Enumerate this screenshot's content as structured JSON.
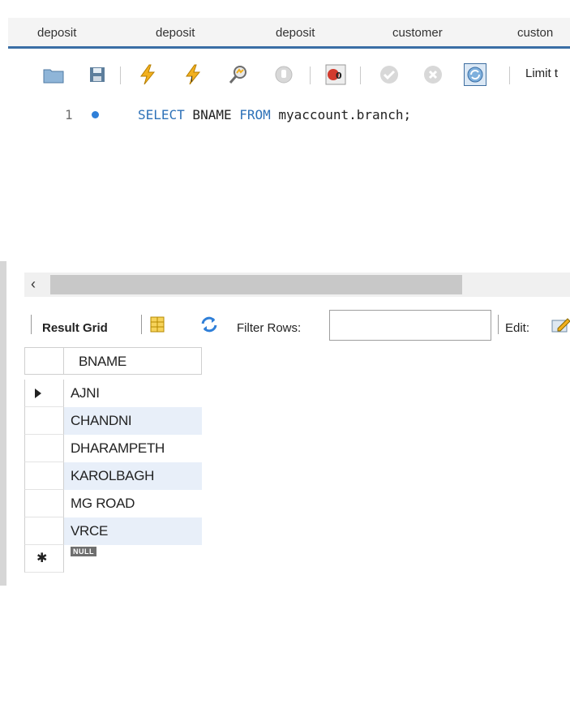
{
  "tabs": [
    "deposit",
    "deposit",
    "deposit",
    "customer",
    "custon"
  ],
  "toolbar": {
    "buttons": [
      {
        "name": "open-file-icon"
      },
      {
        "name": "save-icon"
      },
      {
        "name": "execute-icon"
      },
      {
        "name": "execute-current-icon"
      },
      {
        "name": "explain-icon"
      },
      {
        "name": "stop-icon"
      },
      {
        "name": "toggle-error-icon"
      },
      {
        "name": "commit-icon"
      },
      {
        "name": "rollback-icon"
      },
      {
        "name": "autocommit-icon"
      }
    ],
    "limit_label": "Limit t"
  },
  "editor": {
    "line_number": "1",
    "sql": {
      "kw1": "SELECT",
      "t1": " BNAME ",
      "kw2": "FROM",
      "t2": " myaccount.branch;"
    }
  },
  "result": {
    "grid_label": "Result Grid",
    "filter_label": "Filter Rows:",
    "filter_value": "",
    "edit_label": "Edit:",
    "column": "BNAME",
    "rows": [
      "AJNI",
      "CHANDNI",
      "DHARAMPETH",
      "KAROLBAGH",
      "MG ROAD",
      "VRCE"
    ],
    "null_label": "NULL"
  },
  "colors": {
    "keyword": "#2e72b8",
    "tab_underline": "#3a6ea5",
    "row_alt": "#e8eff9"
  }
}
